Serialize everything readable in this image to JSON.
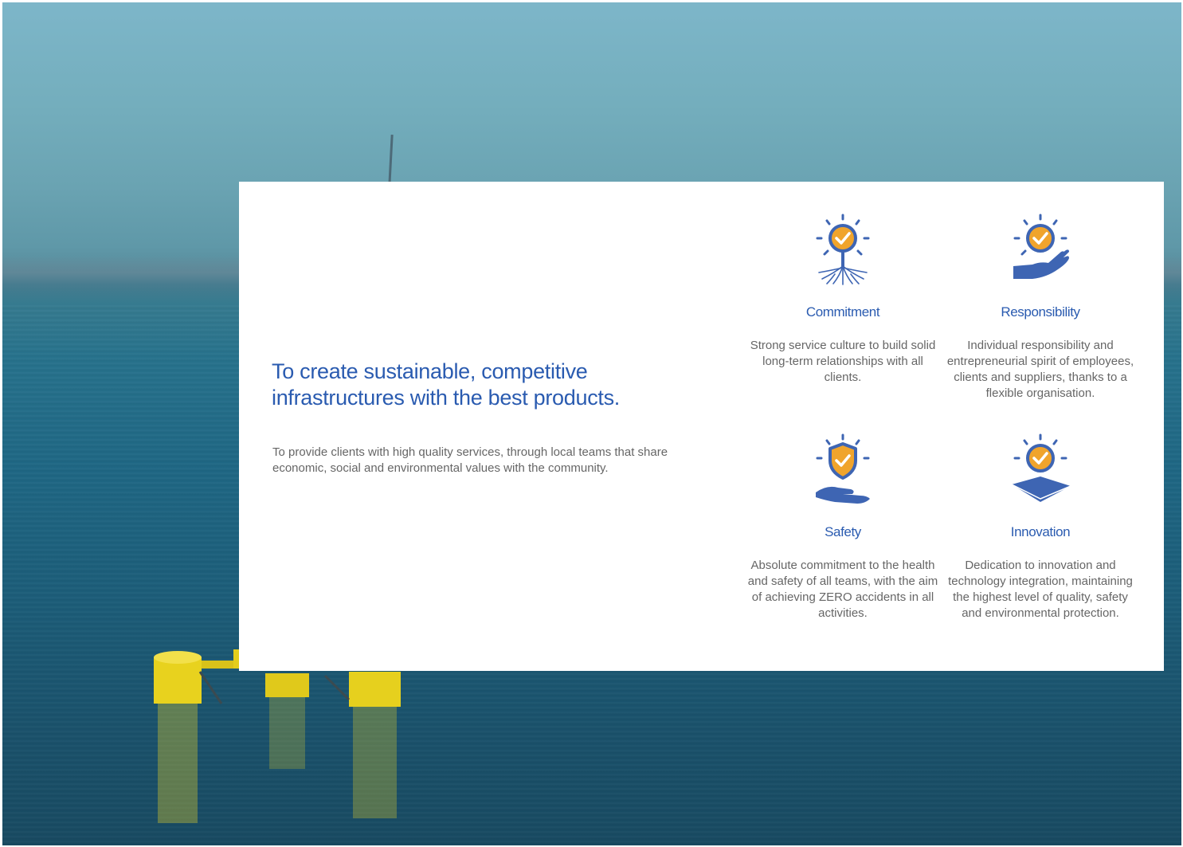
{
  "headline": "To create sustainable, competitive infrastructures with the best products.",
  "mission": "To provide clients with high quality services, through local teams that share economic, social and environmental values with the community.",
  "values": [
    {
      "icon": "tree-roots-sun-check-icon",
      "title": "Commitment",
      "text": "Strong service culture to build solid long-term relationships with all clients."
    },
    {
      "icon": "hand-sun-check-icon",
      "title": "Responsibility",
      "text": "Individual responsibility and entrepreneurial spirit of employees, clients and suppliers, thanks to a flexible organisation."
    },
    {
      "icon": "shield-hand-check-icon",
      "title": "Safety",
      "text": "Absolute commitment to the health and safety of all teams, with the aim of achieving ZERO accidents in all activities."
    },
    {
      "icon": "layers-sun-check-icon",
      "title": "Innovation",
      "text": "Dedication to innovation and technology integration, maintaining the highest level of quality, safety and environmental protection."
    }
  ],
  "colors": {
    "accent": "#2a5bb0",
    "icon_blue": "#3e65b3",
    "icon_orange": "#f0a42c",
    "body_text": "#666666"
  }
}
